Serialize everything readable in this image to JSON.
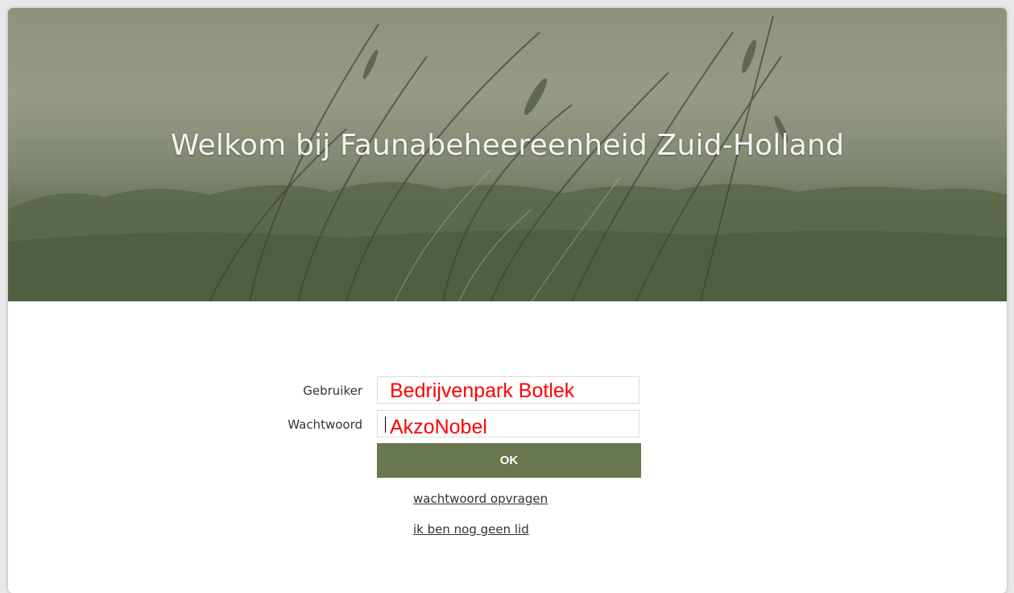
{
  "banner": {
    "title": "Welkom bij Faunabeheereenheid Zuid-Holland",
    "colors": {
      "top": "#8d927c",
      "bottom": "#56644a"
    }
  },
  "login": {
    "user_label": "Gebruiker",
    "user_value": "Bedrijvenpark Botlek",
    "password_label": "Wachtwoord",
    "password_value": "AkzoNobel",
    "ok_label": "OK",
    "forgot_link": "wachtwoord opvragen",
    "register_link": "ik ben nog geen lid"
  },
  "colors": {
    "button": "#69784f",
    "field_text": "#ff0000"
  }
}
